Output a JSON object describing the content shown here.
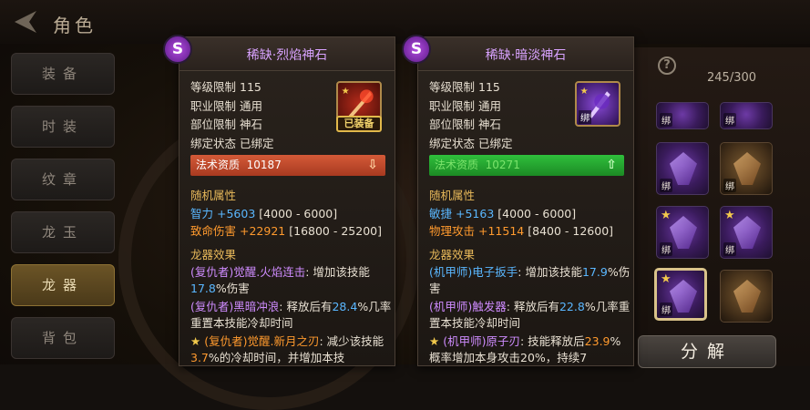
{
  "page": {
    "title": "角色"
  },
  "sidebar": {
    "items": [
      {
        "label": "装备",
        "active": false
      },
      {
        "label": "时装",
        "active": false
      },
      {
        "label": "纹章",
        "active": false
      },
      {
        "label": "龙玉",
        "active": false
      },
      {
        "label": "龙器",
        "active": true
      },
      {
        "label": "背包",
        "active": false
      }
    ]
  },
  "inventory": {
    "count": "245/300",
    "help": "?",
    "decompose_label": "分解",
    "bind_label": "绑"
  },
  "card_left": {
    "title": "稀缺·烈焰神石",
    "badge": "S",
    "rows": [
      {
        "k": "等级限制",
        "v": "115"
      },
      {
        "k": "职业限制",
        "v": "通用"
      },
      {
        "k": "部位限制",
        "v": "神石"
      },
      {
        "k": "绑定状态",
        "v": "已绑定"
      }
    ],
    "equipped_label": "已装备",
    "stat_bar": {
      "label": "法术资质",
      "value": "10187",
      "arrow": "⇩"
    },
    "random_title": "随机属性",
    "random": [
      {
        "k": "智力",
        "plus": "+5603",
        "range": "[4000 - 6000]"
      },
      {
        "k": "致命伤害",
        "plus": "+22921",
        "range": "[16800 - 25200]"
      }
    ],
    "effects_title": "龙器效果",
    "effects": [
      {
        "tag": "(复仇者)",
        "name": "觉醒.火焰连击",
        "t1": ": 增加该技能",
        "pct": "17.8",
        "t2": "%伤害",
        "star": false
      },
      {
        "tag": "(复仇者)",
        "name": "黑暗冲浪",
        "t1": ": 释放后有",
        "pct": "28.4",
        "t2": "%几率重置本技能冷却时间",
        "star": false
      },
      {
        "tag": "(复仇者)",
        "name": "觉醒.新月之刃",
        "t1": ": 减少该技能",
        "pct": "3.7",
        "t2": "%的冷却时间，并增加本技",
        "star": true
      }
    ]
  },
  "card_right": {
    "title": "稀缺·暗淡神石",
    "badge": "S",
    "rows": [
      {
        "k": "等级限制",
        "v": "115"
      },
      {
        "k": "职业限制",
        "v": "通用"
      },
      {
        "k": "部位限制",
        "v": "神石"
      },
      {
        "k": "绑定状态",
        "v": "已绑定"
      }
    ],
    "bind_label": "绑",
    "stat_bar": {
      "label": "法术资质",
      "value": "10271",
      "arrow": "⇧"
    },
    "random_title": "随机属性",
    "random": [
      {
        "k": "敏捷",
        "plus": "+5163",
        "range": "[4000 - 6000]"
      },
      {
        "k": "物理攻击",
        "plus": "+11514",
        "range": "[8400 - 12600]"
      }
    ],
    "effects_title": "龙器效果",
    "effects": [
      {
        "tag": "(机甲师)",
        "name": "电子扳手",
        "t1": ": 增加该技能",
        "pct": "17.9",
        "t2": "%伤害",
        "star": false
      },
      {
        "tag": "(机甲师)",
        "name": "触发器",
        "t1": ": 释放后有",
        "pct": "22.8",
        "t2": "%几率重置本技能冷却时间",
        "star": false
      },
      {
        "tag": "(机甲师)",
        "name": "原子刃",
        "t1": ": 技能释放后",
        "pct": "23.9",
        "t2": "%概率增加本身攻击20%，持续7",
        "star": true
      }
    ]
  },
  "colors": {
    "accent_gold": "#e2b94b",
    "purple": "#cf8cff",
    "red_bar": "#c84a2c",
    "green_bar": "#28a834"
  }
}
